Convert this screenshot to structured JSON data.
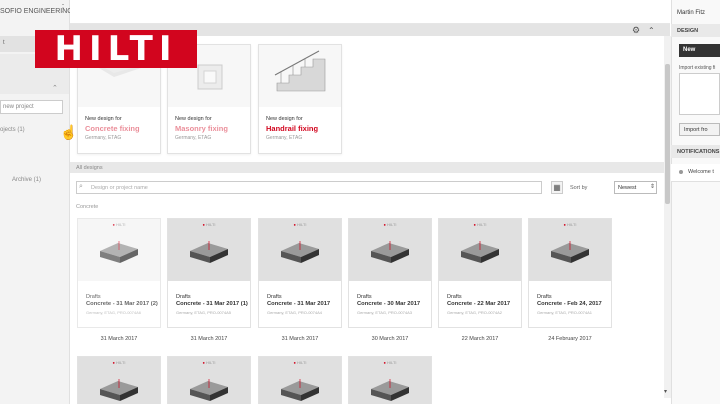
{
  "sidebar": {
    "title": "SOFIO ENGINEERING",
    "selected_label": "t",
    "new_project": "new project",
    "projects_label": "ojects (1)",
    "archive_label": "Archive (1)"
  },
  "header": {
    "gear": "⚙",
    "collapse": "⌃"
  },
  "logo": {
    "text": "HILTI"
  },
  "new_designs": [
    {
      "sub": "New design for",
      "title": "Concrete fixing",
      "meta": "Germany, ETAG"
    },
    {
      "sub": "New design for",
      "title": "Masonry fixing",
      "meta": "Germany, ETAG"
    },
    {
      "sub": "New design for",
      "title": "Handrail fixing",
      "meta": "Germany, ETAG"
    }
  ],
  "all_designs": {
    "heading": "All designs",
    "search_placeholder": "Design or project name",
    "sort_label": "Sort by",
    "sort_value": "Newest",
    "group_label": "Concrete"
  },
  "designs": [
    {
      "brand": "HILTI",
      "state": "Drafts",
      "name": "Concrete - 31 Mar 2017 (2)",
      "meta": "Germany, ETAG, PRO-0074A6",
      "date": "31 March 2017"
    },
    {
      "brand": "HILTI",
      "state": "Drafts",
      "name": "Concrete - 31 Mar 2017 (1)",
      "meta": "Germany, ETAG, PRO-0074A5",
      "date": "31 March 2017"
    },
    {
      "brand": "HILTI",
      "state": "Drafts",
      "name": "Concrete - 31 Mar 2017",
      "meta": "Germany, ETAG, PRO-0074A4",
      "date": "31 March 2017"
    },
    {
      "brand": "HILTI",
      "state": "Drafts",
      "name": "Concrete - 30 Mar 2017",
      "meta": "Germany, ETAG, PRO-0074A3",
      "date": "30 March 2017"
    },
    {
      "brand": "HILTI",
      "state": "Drafts",
      "name": "Concrete - 22 Mar 2017",
      "meta": "Germany, ETAG, PRO-0074A2",
      "date": "22 March 2017"
    },
    {
      "brand": "HILTI",
      "state": "Drafts",
      "name": "Concrete - Feb 24, 2017",
      "meta": "Germany, ETAG, PRO-0074A1",
      "date": "24 February 2017"
    }
  ],
  "designs_row2": [
    {
      "brand": "HILTI"
    },
    {
      "brand": "HILTI"
    },
    {
      "brand": "HILTI"
    },
    {
      "brand": "HILTI"
    }
  ],
  "right_panel": {
    "user": "Martin Fitz",
    "design_heading": "DESIGN",
    "new_label": "New",
    "import_label": "Import existing fi",
    "import_button": "Import fro",
    "notifications_heading": "NOTIFICATIONS",
    "notification_text": "Welcome t"
  },
  "colors": {
    "brand_red": "#d2051e",
    "dark_button": "#333333"
  },
  "icons": [
    "gear-icon",
    "chevron-up-icon",
    "search-icon",
    "grid-view-icon",
    "caret-down-icon",
    "more-vert-icon",
    "cursor-icon"
  ]
}
